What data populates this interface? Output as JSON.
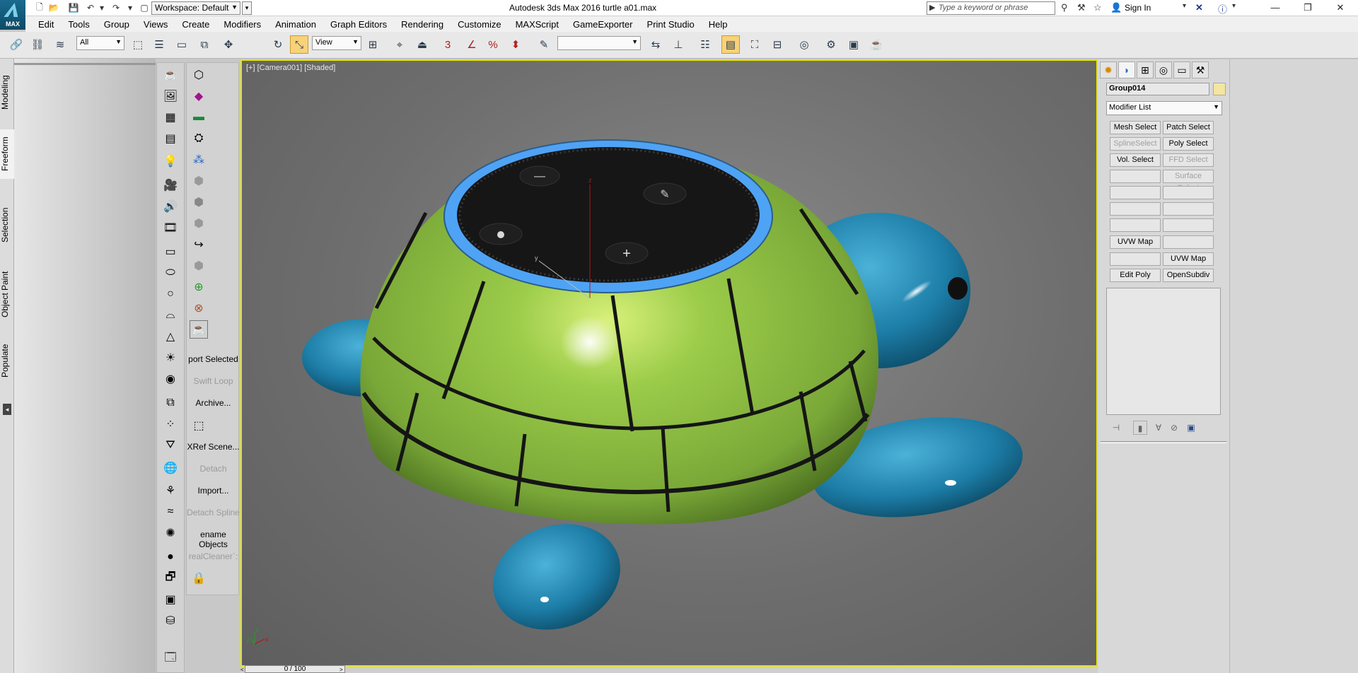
{
  "window": {
    "title": "Autodesk 3ds Max 2016     turtle a01.max",
    "logo_text": "MAX",
    "workspace": "Workspace: Default",
    "search_placeholder": "Type a keyword or phrase",
    "sign_in": "Sign In"
  },
  "menu": [
    "Edit",
    "Tools",
    "Group",
    "Views",
    "Create",
    "Modifiers",
    "Animation",
    "Graph Editors",
    "Rendering",
    "Customize",
    "MAXScript",
    "GameExporter",
    "Print Studio",
    "Help"
  ],
  "toolbar": {
    "selection_filter": "All",
    "reference_coord": "View",
    "snap_label": "3",
    "named_selection": ""
  },
  "left_tabs": [
    "Modeling",
    "Freeform",
    "Selection",
    "Object Paint",
    "Populate"
  ],
  "left_tabs_selected": "Freeform",
  "strip2_labels": [
    {
      "text": "port Selected",
      "dim": false
    },
    {
      "text": "Swift Loop",
      "dim": true
    },
    {
      "text": "Archive...",
      "dim": false
    },
    {
      "text": "XRef Scene...",
      "dim": false
    },
    {
      "text": "Detach",
      "dim": true
    },
    {
      "text": "Import...",
      "dim": false
    },
    {
      "text": "Detach Spline",
      "dim": true
    },
    {
      "text": "ename Objects",
      "dim": false
    },
    {
      "text": "realCleaner`:",
      "dim": true
    }
  ],
  "viewport": {
    "label": "[+] [Camera001] [Shaded]",
    "axis_z": "z",
    "axis_y": "y",
    "gizmo_x": "x",
    "gizmo_y": "y",
    "gizmo_z": "z"
  },
  "timeline": {
    "frame": "0 / 100"
  },
  "command_panel": {
    "object_name": "Group014",
    "modifier_list": "Modifier List",
    "buttons": [
      {
        "text": "Mesh Select",
        "dim": false
      },
      {
        "text": "Patch Select",
        "dim": false
      },
      {
        "text": "SplineSelect",
        "dim": true
      },
      {
        "text": "Poly Select",
        "dim": false
      },
      {
        "text": "Vol. Select",
        "dim": false
      },
      {
        "text": "FFD Select",
        "dim": true
      },
      {
        "text": "",
        "dim": false
      },
      {
        "text": "Surface Select",
        "dim": true
      },
      {
        "text": "",
        "dim": false
      },
      {
        "text": "",
        "dim": false
      },
      {
        "text": "",
        "dim": false
      },
      {
        "text": "",
        "dim": false
      },
      {
        "text": "",
        "dim": false
      },
      {
        "text": "",
        "dim": false
      },
      {
        "text": "UVW Map",
        "dim": false
      },
      {
        "text": "",
        "dim": false
      },
      {
        "text": "",
        "dim": false
      },
      {
        "text": "UVW Map",
        "dim": false
      },
      {
        "text": "Edit Poly",
        "dim": false
      },
      {
        "text": "OpenSubdiv",
        "dim": false
      }
    ]
  },
  "colors": {
    "shell_green": "#8cc63f",
    "turtle_blue": "#1d7ea8",
    "ring_blue": "#4fa3f5",
    "viewport_border": "#e6e600"
  }
}
